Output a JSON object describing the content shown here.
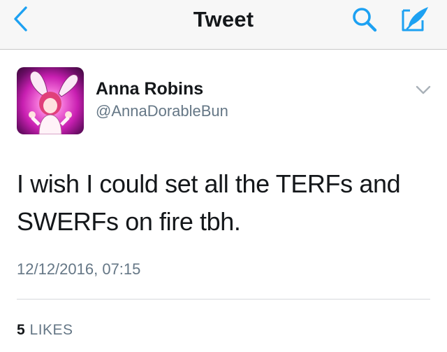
{
  "nav": {
    "title": "Tweet",
    "back_icon": "chevron-left-icon",
    "search_icon": "search-icon",
    "compose_icon": "compose-tweet-icon",
    "accent_color": "#1da1f2"
  },
  "tweet": {
    "author_name": "Anna Robins",
    "author_handle": "@AnnaDorableBun",
    "text_line1": "I wish I could set all the TERFs and",
    "text_line2": "SWERFs on fire tbh.",
    "timestamp": "12/12/2016, 07:15",
    "likes_count": "5",
    "likes_label": "LIKES",
    "menu_icon": "chevron-down-icon"
  }
}
